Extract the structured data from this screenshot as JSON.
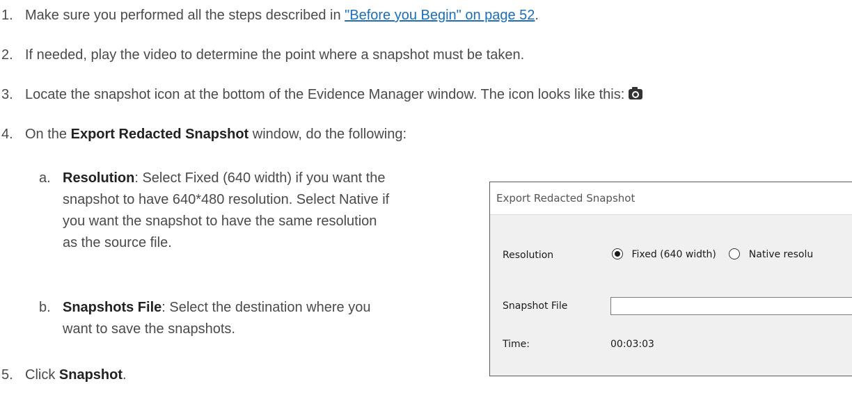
{
  "steps": [
    {
      "num": "1.",
      "text_before": "Make sure you performed all the steps described in ",
      "link": "\"Before you Begin\" on page 52",
      "text_after": "."
    },
    {
      "num": "2.",
      "text": "If needed, play the video to determine the point where a snapshot must be taken."
    },
    {
      "num": "3.",
      "text": "Locate the snapshot icon at the bottom of the Evidence Manager window. The icon looks like this:",
      "icon": "camera-icon"
    },
    {
      "num": "4.",
      "text_before": "On the ",
      "bold": "Export Redacted Snapshot",
      "text_after": " window, do the following:"
    },
    {
      "num": "5.",
      "text_before": "Click ",
      "bold": "Snapshot",
      "text_after": "."
    }
  ],
  "substeps": [
    {
      "letter": "a.",
      "bold": "Resolution",
      "text": ": Select Fixed (640 width) if you want the snapshot to have 640*480 resolution. Select Native if you want the snapshot to have the same resolution as the source file."
    },
    {
      "letter": "b.",
      "bold": "Snapshots File",
      "text": ": Select the destination where you want to save the snapshots."
    }
  ],
  "dialog": {
    "title": "Export Redacted Snapshot",
    "resolution_label": "Resolution",
    "option_fixed": "Fixed (640 width)",
    "option_native": "Native resolu",
    "selected": "Fixed (640 width)",
    "snapshot_file_label": "Snapshot File",
    "snapshot_file_value": "",
    "time_label": "Time:",
    "time_value": "00:03:03"
  }
}
